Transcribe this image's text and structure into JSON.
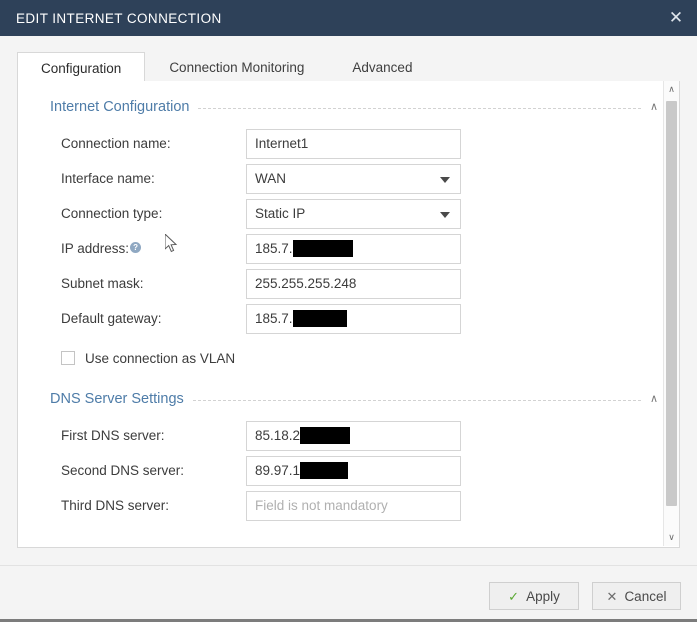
{
  "window": {
    "title": "EDIT INTERNET CONNECTION",
    "close_label": "✕"
  },
  "tabs": [
    {
      "label": "Configuration",
      "active": true
    },
    {
      "label": "Connection Monitoring",
      "active": false
    },
    {
      "label": "Advanced",
      "active": false
    }
  ],
  "sections": [
    {
      "title": "Internet Configuration",
      "chevron": "∧"
    },
    {
      "title": "DNS Server Settings",
      "chevron": "∧"
    }
  ],
  "internet_configuration": {
    "connection_name": {
      "label": "Connection name:",
      "value": "Internet1",
      "type": "text"
    },
    "interface_name": {
      "label": "Interface name:",
      "value": "WAN",
      "type": "select"
    },
    "connection_type": {
      "label": "Connection type:",
      "value": "Static IP",
      "type": "select"
    },
    "ip_address": {
      "label": "IP address:",
      "value": "185.7.",
      "redacted": true,
      "redaction_width": 60,
      "help": "?",
      "type": "text"
    },
    "subnet_mask": {
      "label": "Subnet mask:",
      "value": "255.255.255.248",
      "type": "text"
    },
    "default_gateway": {
      "label": "Default gateway:",
      "value": "185.7.",
      "redacted": true,
      "redaction_width": 54,
      "type": "text"
    },
    "use_vlan": {
      "label": "Use connection as VLAN",
      "checked": false
    }
  },
  "dns_server_settings": {
    "first_dns": {
      "label": "First DNS server:",
      "value": "85.18.2",
      "redacted": true,
      "redaction_width": 50,
      "type": "text"
    },
    "second_dns": {
      "label": "Second DNS server:",
      "value": "89.97.1",
      "redacted": true,
      "redaction_width": 48,
      "type": "text"
    },
    "third_dns": {
      "label": "Third DNS server:",
      "value": "",
      "placeholder": "Field is not mandatory",
      "type": "text"
    }
  },
  "footer": {
    "apply_label": "Apply",
    "apply_glyph": "✓",
    "cancel_label": "Cancel",
    "cancel_glyph": "✕"
  },
  "scrollbar": {
    "up_glyph": "∧",
    "down_glyph": "∨"
  },
  "colors": {
    "titlebar": "#2e4159",
    "section_title": "#4e7ca8",
    "apply_check": "#5aa832",
    "redaction": "#000000"
  }
}
